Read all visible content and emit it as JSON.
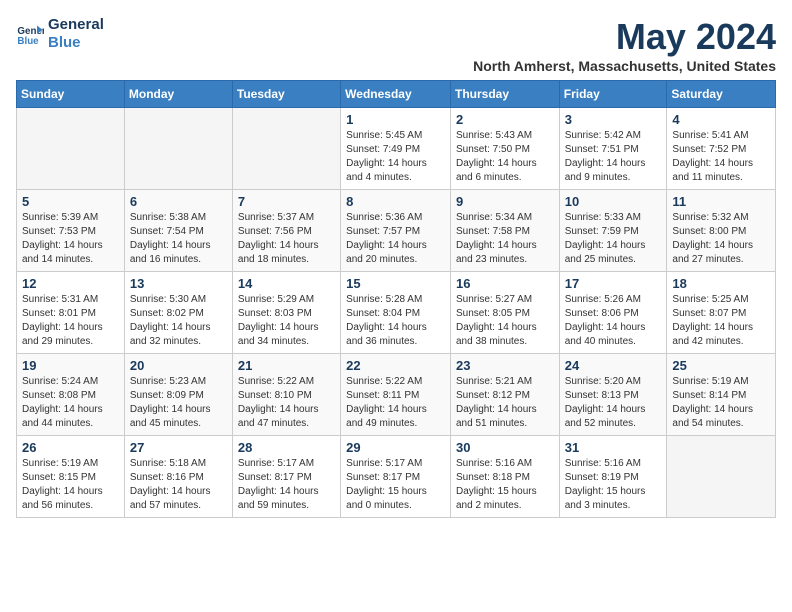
{
  "logo": {
    "line1": "General",
    "line2": "Blue"
  },
  "title": "May 2024",
  "subtitle": "North Amherst, Massachusetts, United States",
  "days_of_week": [
    "Sunday",
    "Monday",
    "Tuesday",
    "Wednesday",
    "Thursday",
    "Friday",
    "Saturday"
  ],
  "weeks": [
    [
      {
        "day": "",
        "info": ""
      },
      {
        "day": "",
        "info": ""
      },
      {
        "day": "",
        "info": ""
      },
      {
        "day": "1",
        "info": "Sunrise: 5:45 AM\nSunset: 7:49 PM\nDaylight: 14 hours\nand 4 minutes."
      },
      {
        "day": "2",
        "info": "Sunrise: 5:43 AM\nSunset: 7:50 PM\nDaylight: 14 hours\nand 6 minutes."
      },
      {
        "day": "3",
        "info": "Sunrise: 5:42 AM\nSunset: 7:51 PM\nDaylight: 14 hours\nand 9 minutes."
      },
      {
        "day": "4",
        "info": "Sunrise: 5:41 AM\nSunset: 7:52 PM\nDaylight: 14 hours\nand 11 minutes."
      }
    ],
    [
      {
        "day": "5",
        "info": "Sunrise: 5:39 AM\nSunset: 7:53 PM\nDaylight: 14 hours\nand 14 minutes."
      },
      {
        "day": "6",
        "info": "Sunrise: 5:38 AM\nSunset: 7:54 PM\nDaylight: 14 hours\nand 16 minutes."
      },
      {
        "day": "7",
        "info": "Sunrise: 5:37 AM\nSunset: 7:56 PM\nDaylight: 14 hours\nand 18 minutes."
      },
      {
        "day": "8",
        "info": "Sunrise: 5:36 AM\nSunset: 7:57 PM\nDaylight: 14 hours\nand 20 minutes."
      },
      {
        "day": "9",
        "info": "Sunrise: 5:34 AM\nSunset: 7:58 PM\nDaylight: 14 hours\nand 23 minutes."
      },
      {
        "day": "10",
        "info": "Sunrise: 5:33 AM\nSunset: 7:59 PM\nDaylight: 14 hours\nand 25 minutes."
      },
      {
        "day": "11",
        "info": "Sunrise: 5:32 AM\nSunset: 8:00 PM\nDaylight: 14 hours\nand 27 minutes."
      }
    ],
    [
      {
        "day": "12",
        "info": "Sunrise: 5:31 AM\nSunset: 8:01 PM\nDaylight: 14 hours\nand 29 minutes."
      },
      {
        "day": "13",
        "info": "Sunrise: 5:30 AM\nSunset: 8:02 PM\nDaylight: 14 hours\nand 32 minutes."
      },
      {
        "day": "14",
        "info": "Sunrise: 5:29 AM\nSunset: 8:03 PM\nDaylight: 14 hours\nand 34 minutes."
      },
      {
        "day": "15",
        "info": "Sunrise: 5:28 AM\nSunset: 8:04 PM\nDaylight: 14 hours\nand 36 minutes."
      },
      {
        "day": "16",
        "info": "Sunrise: 5:27 AM\nSunset: 8:05 PM\nDaylight: 14 hours\nand 38 minutes."
      },
      {
        "day": "17",
        "info": "Sunrise: 5:26 AM\nSunset: 8:06 PM\nDaylight: 14 hours\nand 40 minutes."
      },
      {
        "day": "18",
        "info": "Sunrise: 5:25 AM\nSunset: 8:07 PM\nDaylight: 14 hours\nand 42 minutes."
      }
    ],
    [
      {
        "day": "19",
        "info": "Sunrise: 5:24 AM\nSunset: 8:08 PM\nDaylight: 14 hours\nand 44 minutes."
      },
      {
        "day": "20",
        "info": "Sunrise: 5:23 AM\nSunset: 8:09 PM\nDaylight: 14 hours\nand 45 minutes."
      },
      {
        "day": "21",
        "info": "Sunrise: 5:22 AM\nSunset: 8:10 PM\nDaylight: 14 hours\nand 47 minutes."
      },
      {
        "day": "22",
        "info": "Sunrise: 5:22 AM\nSunset: 8:11 PM\nDaylight: 14 hours\nand 49 minutes."
      },
      {
        "day": "23",
        "info": "Sunrise: 5:21 AM\nSunset: 8:12 PM\nDaylight: 14 hours\nand 51 minutes."
      },
      {
        "day": "24",
        "info": "Sunrise: 5:20 AM\nSunset: 8:13 PM\nDaylight: 14 hours\nand 52 minutes."
      },
      {
        "day": "25",
        "info": "Sunrise: 5:19 AM\nSunset: 8:14 PM\nDaylight: 14 hours\nand 54 minutes."
      }
    ],
    [
      {
        "day": "26",
        "info": "Sunrise: 5:19 AM\nSunset: 8:15 PM\nDaylight: 14 hours\nand 56 minutes."
      },
      {
        "day": "27",
        "info": "Sunrise: 5:18 AM\nSunset: 8:16 PM\nDaylight: 14 hours\nand 57 minutes."
      },
      {
        "day": "28",
        "info": "Sunrise: 5:17 AM\nSunset: 8:17 PM\nDaylight: 14 hours\nand 59 minutes."
      },
      {
        "day": "29",
        "info": "Sunrise: 5:17 AM\nSunset: 8:17 PM\nDaylight: 15 hours\nand 0 minutes."
      },
      {
        "day": "30",
        "info": "Sunrise: 5:16 AM\nSunset: 8:18 PM\nDaylight: 15 hours\nand 2 minutes."
      },
      {
        "day": "31",
        "info": "Sunrise: 5:16 AM\nSunset: 8:19 PM\nDaylight: 15 hours\nand 3 minutes."
      },
      {
        "day": "",
        "info": ""
      }
    ]
  ]
}
